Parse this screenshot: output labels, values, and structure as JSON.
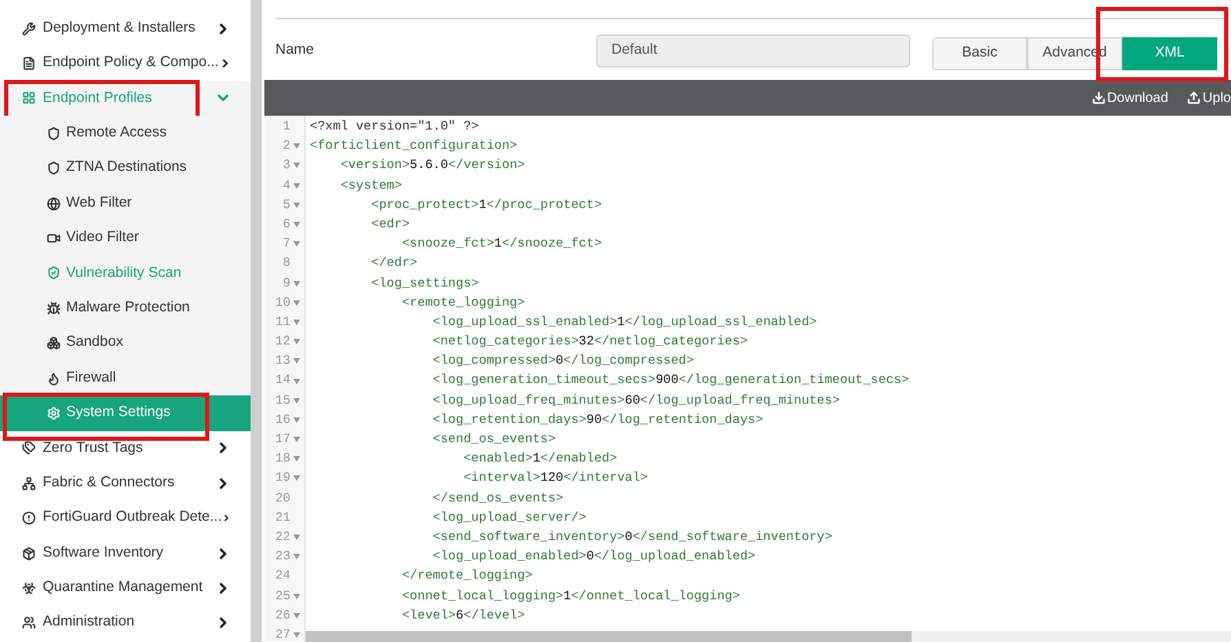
{
  "sidebar": {
    "items": [
      {
        "label": "Deployment & Installers",
        "expanded": false,
        "annotated": false
      },
      {
        "label": "Endpoint Policy & Compo...",
        "expanded": false,
        "annotated": false
      },
      {
        "label": "Endpoint Profiles",
        "expanded": true,
        "annotated": true,
        "children": [
          {
            "label": "Remote Access",
            "selected": false,
            "hovered": false,
            "annotated": false
          },
          {
            "label": "ZTNA Destinations",
            "selected": false,
            "hovered": false,
            "annotated": false
          },
          {
            "label": "Web Filter",
            "selected": false,
            "hovered": false,
            "annotated": false
          },
          {
            "label": "Video Filter",
            "selected": false,
            "hovered": false,
            "annotated": false
          },
          {
            "label": "Vulnerability Scan",
            "selected": false,
            "hovered": true,
            "annotated": false
          },
          {
            "label": "Malware Protection",
            "selected": false,
            "hovered": false,
            "annotated": false
          },
          {
            "label": "Sandbox",
            "selected": false,
            "hovered": false,
            "annotated": false
          },
          {
            "label": "Firewall",
            "selected": false,
            "hovered": false,
            "annotated": false
          },
          {
            "label": "System Settings",
            "selected": true,
            "hovered": false,
            "annotated": true
          }
        ]
      },
      {
        "label": "Zero Trust Tags",
        "expanded": false,
        "annotated": false
      },
      {
        "label": "Fabric & Connectors",
        "expanded": false,
        "annotated": false
      },
      {
        "label": "FortiGuard Outbreak Dete...",
        "expanded": false,
        "annotated": false
      },
      {
        "label": "Software Inventory",
        "expanded": false,
        "annotated": false
      },
      {
        "label": "Quarantine Management",
        "expanded": false,
        "annotated": false
      },
      {
        "label": "Administration",
        "expanded": false,
        "annotated": false
      }
    ]
  },
  "form": {
    "name_label": "Name",
    "name_value": "Default"
  },
  "tabs": [
    {
      "label": "Basic",
      "selected": false,
      "annotated": false
    },
    {
      "label": "Advanced",
      "selected": false,
      "annotated": false
    },
    {
      "label": "XML",
      "selected": true,
      "annotated": true
    }
  ],
  "toolbar": [
    {
      "kind": "download",
      "label": "Download"
    },
    {
      "kind": "upload",
      "label": "Uplo"
    }
  ],
  "editor": {
    "lines": [
      {
        "number": "1",
        "fold": false,
        "text": "<?xml version=\"1.0\" ?>"
      },
      {
        "number": "2",
        "fold": true,
        "text": "<forticlient_configuration>"
      },
      {
        "number": "3",
        "fold": true,
        "text": "    <version>5.6.0</version>"
      },
      {
        "number": "4",
        "fold": true,
        "text": "    <system>"
      },
      {
        "number": "5",
        "fold": true,
        "text": "        <proc_protect>1</proc_protect>"
      },
      {
        "number": "6",
        "fold": true,
        "text": "        <edr>"
      },
      {
        "number": "7",
        "fold": true,
        "text": "            <snooze_fct>1</snooze_fct>"
      },
      {
        "number": "8",
        "fold": false,
        "text": "        </edr>"
      },
      {
        "number": "9",
        "fold": true,
        "text": "        <log_settings>"
      },
      {
        "number": "10",
        "fold": true,
        "text": "            <remote_logging>"
      },
      {
        "number": "11",
        "fold": true,
        "text": "                <log_upload_ssl_enabled>1</log_upload_ssl_enabled>"
      },
      {
        "number": "12",
        "fold": true,
        "text": "                <netlog_categories>32</netlog_categories>"
      },
      {
        "number": "13",
        "fold": true,
        "text": "                <log_compressed>0</log_compressed>"
      },
      {
        "number": "14",
        "fold": true,
        "text": "                <log_generation_timeout_secs>900</log_generation_timeout_secs>"
      },
      {
        "number": "15",
        "fold": true,
        "text": "                <log_upload_freq_minutes>60</log_upload_freq_minutes>"
      },
      {
        "number": "16",
        "fold": true,
        "text": "                <log_retention_days>90</log_retention_days>"
      },
      {
        "number": "17",
        "fold": true,
        "text": "                <send_os_events>"
      },
      {
        "number": "18",
        "fold": true,
        "text": "                    <enabled>1</enabled>"
      },
      {
        "number": "19",
        "fold": true,
        "text": "                    <interval>120</interval>"
      },
      {
        "number": "20",
        "fold": false,
        "text": "                </send_os_events>"
      },
      {
        "number": "21",
        "fold": false,
        "text": "                <log_upload_server/>"
      },
      {
        "number": "22",
        "fold": true,
        "text": "                <send_software_inventory>0</send_software_inventory>"
      },
      {
        "number": "23",
        "fold": true,
        "text": "                <log_upload_enabled>0</log_upload_enabled>"
      },
      {
        "number": "24",
        "fold": false,
        "text": "            </remote_logging>"
      },
      {
        "number": "25",
        "fold": true,
        "text": "            <onnet_local_logging>1</onnet_local_logging>"
      },
      {
        "number": "26",
        "fold": true,
        "text": "            <level>6</level>"
      },
      {
        "number": "27",
        "fold": true
      }
    ]
  }
}
